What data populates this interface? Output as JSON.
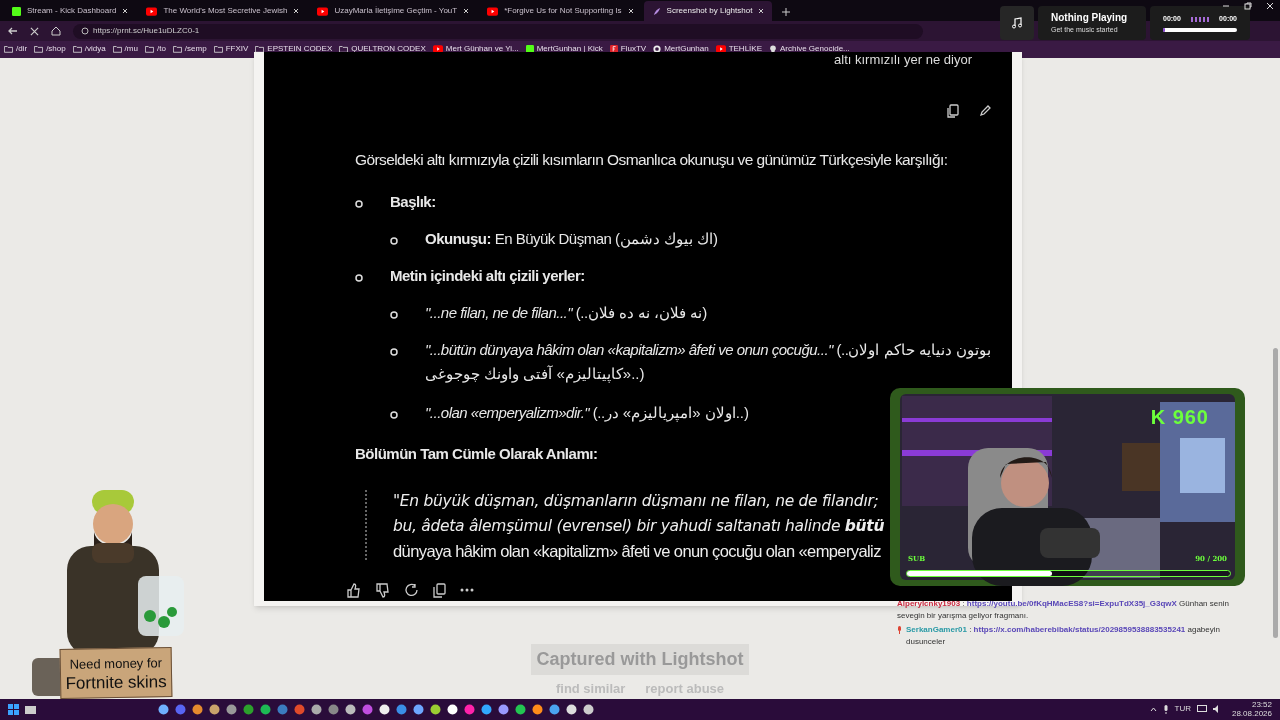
{
  "tabs": [
    {
      "title": "Stream - Kick Dashboard",
      "kind": "kick",
      "selected": false
    },
    {
      "title": "The World's Most Secretive Jewish",
      "kind": "youtube",
      "selected": false
    },
    {
      "title": "UzayMarla İletişime Geçtim - YouT",
      "kind": "youtube",
      "selected": false
    },
    {
      "title": "*Forgive Us for Not Supporting Is",
      "kind": "youtube",
      "selected": false
    },
    {
      "title": "Screenshot by Lightshot",
      "kind": "feather",
      "selected": true
    }
  ],
  "address_bar": {
    "url": "https://prnt.sc/Hue1uDLZC0-1"
  },
  "bookmarks": [
    {
      "label": "/dir",
      "kind": "folder"
    },
    {
      "label": "/shop",
      "kind": "folder"
    },
    {
      "label": "/vidya",
      "kind": "folder"
    },
    {
      "label": "/mu",
      "kind": "folder"
    },
    {
      "label": "/to",
      "kind": "folder"
    },
    {
      "label": "/semp",
      "kind": "folder"
    },
    {
      "label": "FFXIV",
      "kind": "folder"
    },
    {
      "label": "EPSTEIN CODEX",
      "kind": "folder"
    },
    {
      "label": "QUELTRON CODEX",
      "kind": "folder"
    },
    {
      "label": "Mert Günhan ve Yi...",
      "kind": "youtube"
    },
    {
      "label": "MertGunhan | Kick",
      "kind": "kick"
    },
    {
      "label": "FluxTV",
      "kind": "flux"
    },
    {
      "label": "MertGunhan",
      "kind": "github"
    },
    {
      "label": "TEHLİKE",
      "kind": "youtube"
    },
    {
      "label": "Archive Genocide...",
      "kind": "skull"
    }
  ],
  "music_widget": {
    "title": "Nothing Playing",
    "subtitle": "Get the music started",
    "elapsed": "00:00",
    "total": "00:00",
    "level": 0.03
  },
  "chat_screenshot": {
    "user_message": "altı kırmızılı yer ne diyor",
    "intro": "Görseldeki altı kırmızıyla çizili kısımların Osmanlıca okunuşu ve günümüz Türkçesiyle karşılığı:",
    "items": [
      {
        "text": "Başlık:",
        "children": [
          {
            "text": "**Okunuşu:** En Büyük Düşman (اك بيوك دشمن)"
          }
        ]
      },
      {
        "text": "Metin içindeki altı çizili yerler:",
        "children": [
          {
            "text": "*\"...ne filan, ne de filan...\"* (..نه فلان، نه ده فلان)"
          },
          {
            "text": "*\"...bütün dünyaya hâkim olan «kapitalizm» âfeti ve onun çocuğu...\"* (..بوتون دنيايه حاكم اولان «كاپيتاليزم» آفتى واونك چوجوغى..)"
          },
          {
            "text": "*\"...olan «emperyalizm»dir.\"* (..اولان «امپرياليزم» در..)"
          }
        ]
      }
    ],
    "section_title": "Bölümün Tam Cümle Olarak Anlamı:",
    "quote_lines": [
      {
        "text": "\"En büyük düşman, düşmanların düşmanı ne filan, ne de filandır;",
        "italic": true
      },
      {
        "text": "bu, âdeta âlemşümul (evrensel) bir yahudi saltanatı halinde **bütü**",
        "italic": true
      },
      {
        "text": "dünyaya hâkim olan «kapitalizm» âfeti ve onun çocuğu olan «emperyaliz",
        "italic": false
      }
    ]
  },
  "lightshot": {
    "caption": "Captured with Lightshot",
    "links": [
      "find similar",
      "report abuse"
    ]
  },
  "stream_overlay": {
    "counter": "K 960",
    "sub_label": "SUB",
    "sub_count": "90 / 200",
    "level": 0.45
  },
  "chat": [
    {
      "user": "Alperylcnky1903",
      "separator": ":",
      "color": "#c8283f",
      "badge": false,
      "link": "https://youtu.be/0fKqHMacES8?si=ExpuTdX35j_G3qwX",
      "message": "Günhan senin sevegin bir yarışma geliyor fragmanı."
    },
    {
      "user": "SerkanGamer01",
      "separator": ":",
      "color": "#2a9aa6",
      "badge": true,
      "link": "https://x.com/haberebibak/status/2029859538883535241",
      "message": "agabeyin dusunceler"
    }
  ],
  "sign": [
    "Need money for",
    "Fortnite skins"
  ],
  "taskbar": {
    "language": "TUR",
    "time": "23:52",
    "date": "28.08.2026"
  }
}
